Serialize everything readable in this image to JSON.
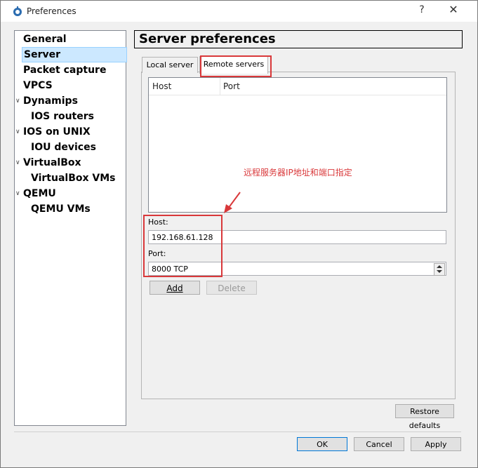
{
  "window": {
    "title": "Preferences",
    "help_label": "?",
    "close_label": "✕"
  },
  "nav": {
    "items": [
      {
        "label": "General"
      },
      {
        "label": "Server"
      },
      {
        "label": "Packet capture"
      },
      {
        "label": "VPCS"
      },
      {
        "label": "Dynamips"
      },
      {
        "label": "IOS routers"
      },
      {
        "label": "IOS on UNIX"
      },
      {
        "label": "IOU devices"
      },
      {
        "label": "VirtualBox"
      },
      {
        "label": "VirtualBox VMs"
      },
      {
        "label": "QEMU"
      },
      {
        "label": "QEMU VMs"
      }
    ],
    "selected": "Server"
  },
  "panel": {
    "title": "Server preferences",
    "tabs": [
      {
        "label": "Local server"
      },
      {
        "label": "Remote servers"
      }
    ],
    "table": {
      "columns": [
        "Host",
        "Port"
      ]
    },
    "host_label": "Host:",
    "host_value": "192.168.61.128",
    "port_label": "Port:",
    "port_value": "8000 TCP",
    "add_label": "Add",
    "delete_label": "Delete",
    "restore_label": "Restore defaults"
  },
  "annotation": {
    "text": "远程服务器IP地址和端口指定",
    "color": "#d9383a"
  },
  "footer": {
    "ok_label": "OK",
    "cancel_label": "Cancel",
    "apply_label": "Apply"
  }
}
